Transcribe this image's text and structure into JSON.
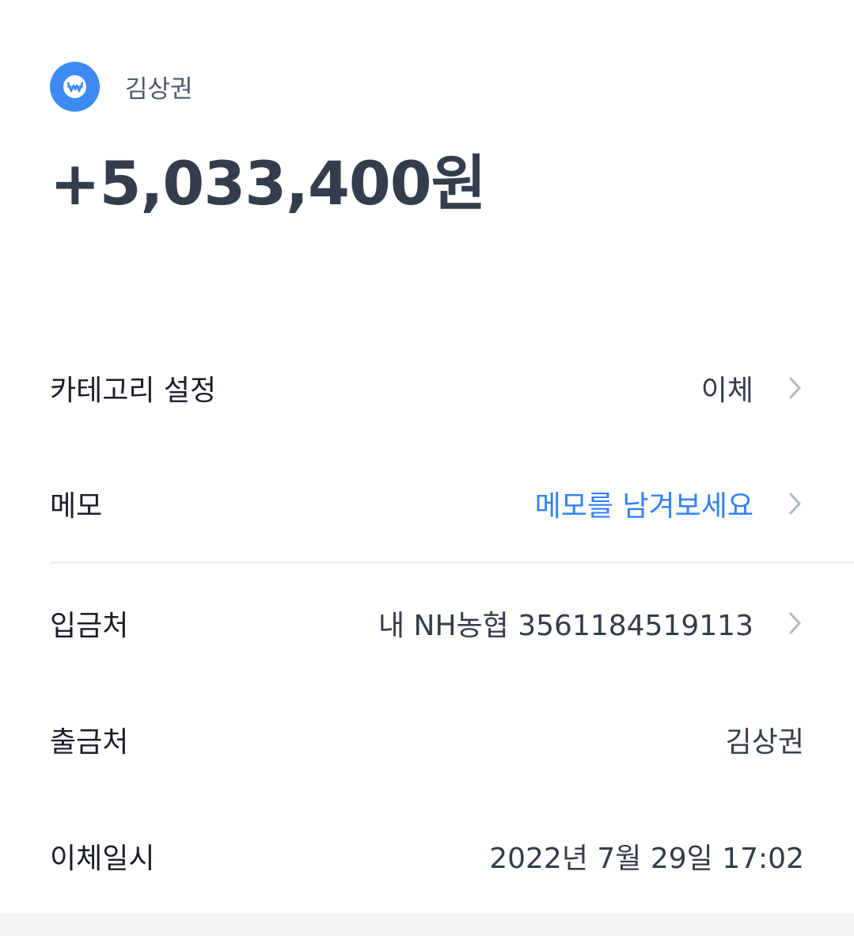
{
  "header": {
    "logo_icon": "won-coin-icon",
    "sender_name": "김상권"
  },
  "amount": "+5,033,400원",
  "rows": {
    "category": {
      "label": "카테고리 설정",
      "value": "이체"
    },
    "memo": {
      "label": "메모",
      "value": "메모를 남겨보세요"
    },
    "deposit_to": {
      "label": "입금처",
      "value": "내 NH농협 3561184519113"
    },
    "withdraw_from": {
      "label": "출금처",
      "value": "김상권"
    },
    "transfer_datetime": {
      "label": "이체일시",
      "value": "2022년 7월 29일 17:02"
    }
  },
  "colors": {
    "accent": "#3d8bf2",
    "link": "#3182f6",
    "amount_text": "#333d4b"
  }
}
